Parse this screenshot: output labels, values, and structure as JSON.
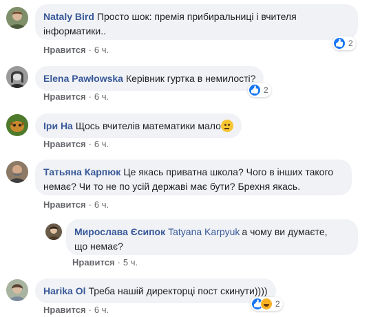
{
  "comments": [
    {
      "author": "Nataly Bird",
      "text": "Просто шок: премія прибиральниці і вчителя інформатики..",
      "text_line1": "Просто шок: премія прибиральниці і вчителя",
      "text_line2": "інформатики..",
      "like_label": "Нравится",
      "time": "6 ч.",
      "reactions": {
        "types": [
          "like"
        ],
        "count": "2"
      }
    },
    {
      "author": "Elena Pawłowska",
      "text": "Керівник гуртка в немилості?",
      "like_label": "Нравится",
      "time": "6 ч.",
      "reactions": {
        "types": [
          "like"
        ],
        "count": "2"
      }
    },
    {
      "author": "Іри На",
      "text": "Щось вчителів математики мало",
      "emoji": "thinking-face",
      "like_label": "Нравится",
      "time": "6 ч."
    },
    {
      "author": "Татьяна Карпюк",
      "text_line1": "Це якась приватна школа? Чого в інших такого",
      "text_line2": "немає? Чи то не по усій державі має бути? Брехня якась.",
      "like_label": "Нравится",
      "time": "6 ч."
    },
    {
      "author": "Мирослава Єсипок",
      "mention": "Tatyana Karpyuk",
      "text_line1": "а чому ви думаєте,",
      "text_line2": "що немає?",
      "like_label": "Нравится",
      "time": "5 ч."
    },
    {
      "author": "Harika Ol",
      "text": "Треба нашій директорці пост скинути))))",
      "like_label": "Нравится",
      "time": "6 ч.",
      "reactions": {
        "types": [
          "like",
          "haha"
        ],
        "count": "2"
      }
    }
  ],
  "separator": "·",
  "colors": {
    "author": "#385898",
    "bubble": "#f0f2f5",
    "meta": "#65676b",
    "like_reaction": "#1877f2",
    "haha_reaction": "#f7b125"
  }
}
